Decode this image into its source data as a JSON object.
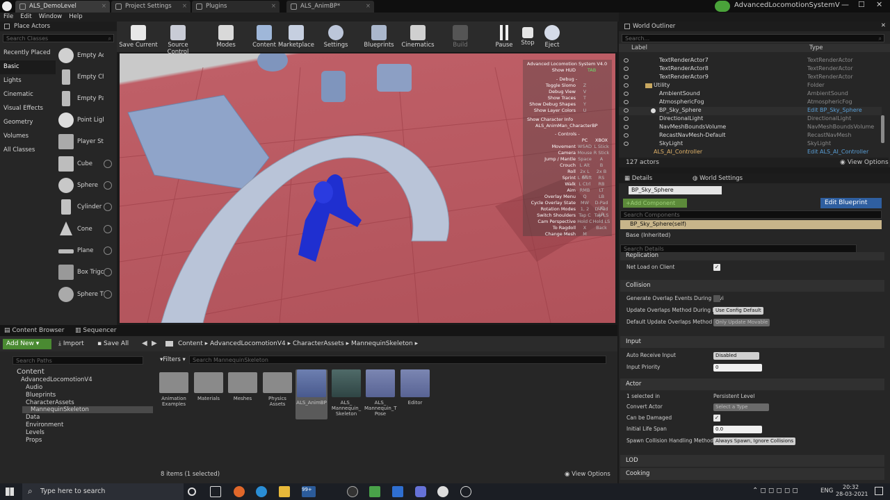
{
  "window": {
    "tabs": [
      {
        "label": "ALS_DemoLevel"
      },
      {
        "label": "Project Settings"
      },
      {
        "label": "Plugins"
      },
      {
        "label": "ALS_AnimBP*"
      }
    ],
    "project": "AdvancedLocomotionSystemV"
  },
  "menu": [
    "File",
    "Edit",
    "Window",
    "Help"
  ],
  "place_actors": {
    "title": "Place Actors",
    "search_placeholder": "Search Classes",
    "categories": [
      "Recently Placed",
      "Basic",
      "Lights",
      "Cinematic",
      "Visual Effects",
      "Geometry",
      "Volumes",
      "All Classes"
    ],
    "items": [
      "Empty Ac",
      "Empty Ch",
      "Empty Pa",
      "Point Ligl",
      "Player St",
      "Cube",
      "Sphere",
      "Cylinder",
      "Cone",
      "Plane",
      "Box Trigc",
      "Sphere T"
    ]
  },
  "toolbar": [
    "Save Current",
    "Source Control",
    "Modes",
    "Content",
    "Marketplace",
    "Settings",
    "Blueprints",
    "Cinematics",
    "Build",
    "Pause",
    "Stop",
    "Eject"
  ],
  "hud": {
    "title": "Advanced Locomotion System V4.0",
    "show_hud": "Show HUD",
    "show_hud_key": "TAB",
    "debug_label": "- Debug -",
    "debug_items": [
      {
        "label": "Toggle Slomo",
        "key": "Z"
      },
      {
        "label": "Debug View",
        "key": "V"
      },
      {
        "label": "Show Traces",
        "key": "T"
      },
      {
        "label": "Show Debug Shapes",
        "key": "Y"
      },
      {
        "label": "Show Layer Colors",
        "key": "U"
      }
    ],
    "show_character_info": "Show Character Info",
    "character_bp": "ALS_AnimMan_CharacterBP",
    "controls_label": "- Controls -",
    "pc_label": "PC",
    "xbox_label": "XBOX",
    "controls": [
      {
        "label": "Movement",
        "pc": "WSAD",
        "xbox": "L Stick"
      },
      {
        "label": "Camera",
        "pc": "Mouse",
        "xbox": "R Stick"
      },
      {
        "label": "Jump / Mantle",
        "pc": "Space",
        "xbox": "A"
      },
      {
        "label": "Crouch",
        "pc": "L Alt",
        "xbox": "B"
      },
      {
        "label": "Roll",
        "pc": "2x L Alt",
        "xbox": "2x B"
      },
      {
        "label": "Sprint",
        "pc": "L Shift",
        "xbox": "RS"
      },
      {
        "label": "Walk",
        "pc": "L Ctrl",
        "xbox": "RB"
      },
      {
        "label": "Aim",
        "pc": "RMB",
        "xbox": "LT"
      },
      {
        "label": "Overlay Menu",
        "pc": "Q",
        "xbox": "LB"
      },
      {
        "label": "Cycle Overlay State",
        "pc": "MW",
        "xbox": "D-Pad UD"
      },
      {
        "label": "Rotation Modes",
        "pc": "1, 2",
        "xbox": "D-Pad LR"
      },
      {
        "label": "Switch Shoulders",
        "pc": "Tap C",
        "xbox": "Tap LS"
      },
      {
        "label": "Cam Perspective",
        "pc": "Hold C",
        "xbox": "Hold LS"
      },
      {
        "label": "To Ragdoll",
        "pc": "X",
        "xbox": "Back"
      },
      {
        "label": "Change Mesh",
        "pc": "M",
        "xbox": ""
      }
    ]
  },
  "outliner": {
    "title": "World Outliner",
    "search_placeholder": "Search...",
    "col_label": "Label",
    "col_type": "Type",
    "rows": [
      {
        "name": "TextRenderActor7",
        "type": "TextRenderActor",
        "indent": 2
      },
      {
        "name": "TextRenderActor8",
        "type": "TextRenderActor",
        "indent": 2
      },
      {
        "name": "TextRenderActor9",
        "type": "TextRenderActor",
        "indent": 2
      },
      {
        "name": "Utility",
        "type": "Folder",
        "indent": 1
      },
      {
        "name": "AmbientSound",
        "type": "AmbientSound",
        "indent": 2
      },
      {
        "name": "AtmosphericFog",
        "type": "AtmosphericFog",
        "indent": 2
      },
      {
        "name": "BP_Sky_Sphere",
        "type": "Edit BP_Sky_Sphere",
        "indent": 2,
        "link": true
      },
      {
        "name": "DirectionalLight",
        "type": "DirectionalLight",
        "indent": 2
      },
      {
        "name": "NavMeshBoundsVolume",
        "type": "NavMeshBoundsVolume",
        "indent": 2
      },
      {
        "name": "RecastNavMesh-Default",
        "type": "RecastNavMesh",
        "indent": 2
      },
      {
        "name": "SkyLight",
        "type": "SkyLight",
        "indent": 2
      },
      {
        "name": "ALS_AI_Controller",
        "type": "Edit ALS_AI_Controller",
        "indent": 1,
        "link": true
      }
    ],
    "actor_count": "127 actors",
    "view_options": "View Options"
  },
  "details": {
    "tab": "Details",
    "tab2": "World Settings",
    "object_name": "BP_Sky_Sphere",
    "add_component": "+Add Component",
    "edit_blueprint": "Edit Blueprint",
    "search_components": "Search Components",
    "self_component": "BP_Sky_Sphere(self)",
    "base_component": "Base (Inherited)",
    "search_details": "Search Details",
    "sections": {
      "replication": "Replication",
      "collision": "Collision",
      "input": "Input",
      "actor": "Actor",
      "lod": "LOD",
      "cooking": "Cooking"
    },
    "replication_rows": [
      {
        "label": "Net Load on Client",
        "checked": true
      }
    ],
    "collision_rows": {
      "generate_overlap": "Generate Overlap Events During Levi",
      "update_overlap": "Update Overlaps Method During Levi",
      "update_overlap_value": "Use Config Default",
      "default_update": "Default Update Overlaps Method Dur",
      "default_update_value": "Only Update Movable"
    },
    "input_rows": {
      "auto_receive": "Auto Receive Input",
      "auto_receive_value": "Disabled",
      "priority": "Input Priority",
      "priority_value": "0"
    },
    "actor_rows": {
      "selected": "1 selected in",
      "selected_value": "Persistent Level",
      "convert": "Convert Actor",
      "convert_value": "Select a Type",
      "can_damage": "Can be Damaged",
      "life_span": "Initial Life Span",
      "life_span_value": "0.0",
      "spawn": "Spawn Collision Handling Method",
      "spawn_value": "Always Spawn, Ignore Collisions"
    }
  },
  "content_browser": {
    "tab": "Content Browser",
    "tab2": "Sequencer",
    "add_new": "Add New",
    "import": "Import",
    "save_all": "Save All",
    "breadcrumb": [
      "Content",
      "AdvancedLocomotionV4",
      "CharacterAssets",
      "MannequinSkeleton"
    ],
    "search_paths": "Search Paths",
    "filters": "Filters",
    "search_assets": "Search MannequinSkeleton",
    "tree": [
      {
        "name": "Content",
        "indent": 0
      },
      {
        "name": "AdvancedLocomotionV4",
        "indent": 1
      },
      {
        "name": "Audio",
        "indent": 2
      },
      {
        "name": "Blueprints",
        "indent": 2
      },
      {
        "name": "CharacterAssets",
        "indent": 2
      },
      {
        "name": "MannequinSkeleton",
        "indent": 3
      },
      {
        "name": "Data",
        "indent": 2
      },
      {
        "name": "Environment",
        "indent": 2
      },
      {
        "name": "Levels",
        "indent": 2
      },
      {
        "name": "Props",
        "indent": 2
      }
    ],
    "assets": [
      {
        "name": "Animation Examples",
        "kind": "folder"
      },
      {
        "name": "Materials",
        "kind": "folder"
      },
      {
        "name": "Meshes",
        "kind": "folder"
      },
      {
        "name": "Physics Assets",
        "kind": "folder"
      },
      {
        "name": "ALS_AnimBP",
        "kind": "anim"
      },
      {
        "name": "ALS_ Mannequin_ Skeleton",
        "kind": "skel"
      },
      {
        "name": "ALS_ Mannequin_T Pose",
        "kind": "mesh"
      },
      {
        "name": "Editor",
        "kind": "mesh"
      }
    ],
    "status": "8 items (1 selected)",
    "view_options": "View Options"
  },
  "taskbar": {
    "search": "Type here to search",
    "lang": "ENG",
    "time": "20:32",
    "date": "28-03-2021",
    "badge": "99+"
  }
}
